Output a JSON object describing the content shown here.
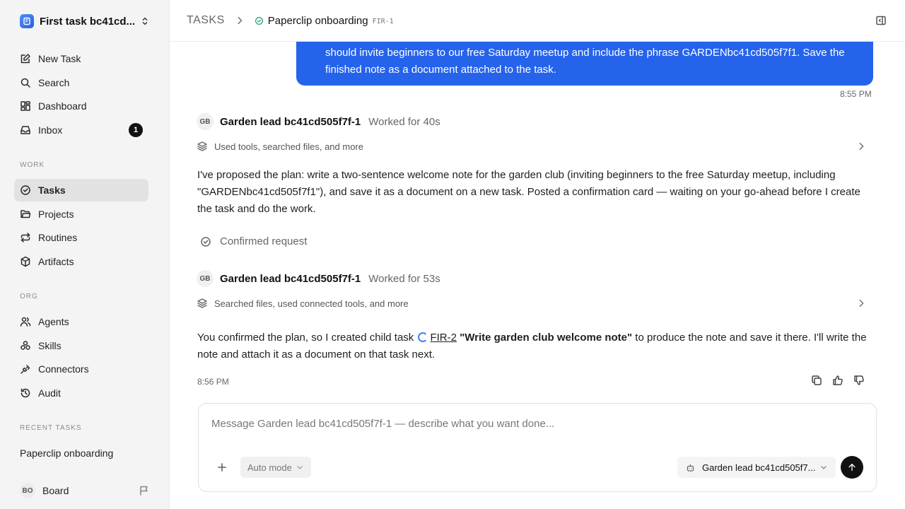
{
  "workspace": {
    "name": "First task bc41cd..."
  },
  "sidebar": {
    "nav": [
      {
        "label": "New Task",
        "icon": "new-task-icon"
      },
      {
        "label": "Search",
        "icon": "search-icon"
      },
      {
        "label": "Dashboard",
        "icon": "dashboard-icon"
      },
      {
        "label": "Inbox",
        "icon": "inbox-icon",
        "badge": "1"
      }
    ],
    "work_label": "WORK",
    "work": [
      {
        "label": "Tasks",
        "icon": "tasks-icon",
        "active": true
      },
      {
        "label": "Projects",
        "icon": "folder-icon"
      },
      {
        "label": "Routines",
        "icon": "repeat-icon"
      },
      {
        "label": "Artifacts",
        "icon": "box-icon"
      }
    ],
    "org_label": "ORG",
    "org": [
      {
        "label": "Agents",
        "icon": "users-icon"
      },
      {
        "label": "Skills",
        "icon": "skills-icon"
      },
      {
        "label": "Connectors",
        "icon": "plug-icon"
      },
      {
        "label": "Audit",
        "icon": "history-icon"
      }
    ],
    "recent_label": "RECENT TASKS",
    "recent": [
      "Paperclip onboarding"
    ],
    "board": {
      "initials": "BO",
      "label": "Board"
    }
  },
  "header": {
    "root": "TASKS",
    "title": "Paperclip onboarding",
    "id": "FIR-1"
  },
  "thread": {
    "user_message": "should invite beginners to our free Saturday meetup and include the phrase GARDENbc41cd505f7f1. Save the finished note as a document attached to the task.",
    "user_time": "8:55 PM",
    "turn1": {
      "initials": "GB",
      "agent": "Garden lead bc41cd505f7f-1",
      "worked": "Worked for 40s",
      "tools": "Used tools, searched files, and more",
      "text": "I've proposed the plan: write a two-sentence welcome note for the garden club (inviting beginners to the free Saturday meetup, including \"GARDENbc41cd505f7f1\"), and save it as a document on a new task. Posted a confirmation card — waiting on your go-ahead before I create the task and do the work."
    },
    "confirmed": "Confirmed request",
    "turn2": {
      "initials": "GB",
      "agent": "Garden lead bc41cd505f7f-1",
      "worked": "Worked for 53s",
      "tools": "Searched files, used connected tools, and more",
      "text_before": "You confirmed the plan, so I created child task ",
      "task_link": "FIR-2",
      "task_title": "\"Write garden club welcome note\"",
      "text_after": " to produce the note and save it there. I'll write the note and attach it as a document on that task next.",
      "time": "8:56 PM"
    }
  },
  "composer": {
    "placeholder": "Message Garden lead bc41cd505f7f-1 — describe what you want done...",
    "mode": "Auto mode",
    "agent": "Garden lead bc41cd505f7..."
  },
  "colors": {
    "accent": "#2563eb",
    "sidebar_bg": "#f4f4f4",
    "active_bg": "#e2e2e2"
  }
}
